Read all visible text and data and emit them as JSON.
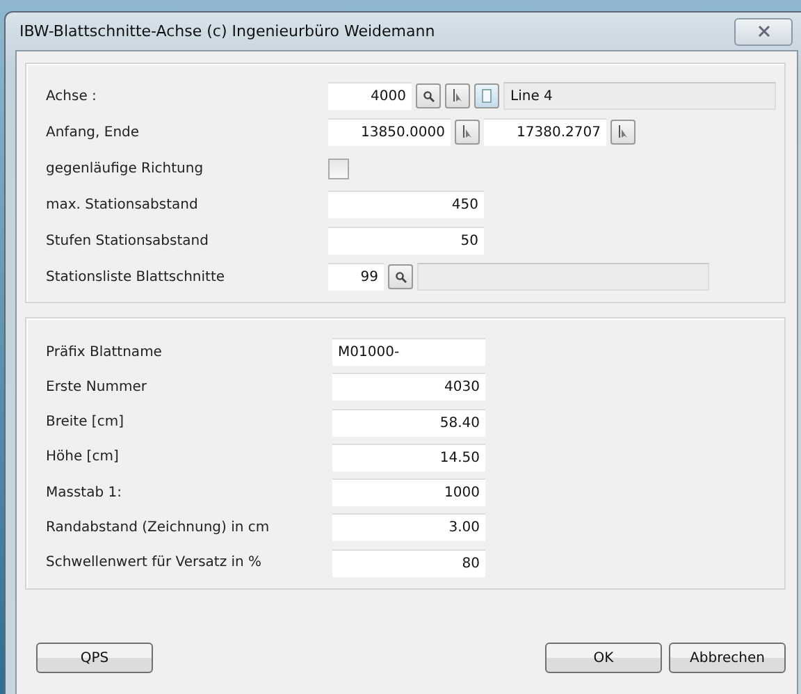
{
  "window": {
    "title": "IBW-Blattschnitte-Achse   (c) Ingenieurbüro Weidemann"
  },
  "upper_group": [
    {
      "label": "Achse :",
      "controls": [
        {
          "kind": "field",
          "value": "4000"
        },
        {
          "kind": "search"
        },
        {
          "kind": "pick"
        },
        {
          "kind": "info"
        },
        {
          "kind": "display",
          "value": "Line 4"
        }
      ]
    },
    {
      "label": "Anfang, Ende",
      "controls": [
        {
          "kind": "field",
          "value": "13850.0000"
        },
        {
          "kind": "pick"
        },
        {
          "kind": "field",
          "value": "17380.2707"
        },
        {
          "kind": "pick"
        }
      ]
    },
    {
      "label": "gegenläufige Richtung",
      "controls": [
        {
          "kind": "checkbox",
          "checked": false
        }
      ]
    },
    {
      "label": "max. Stationsabstand",
      "controls": [
        {
          "kind": "field",
          "value": "450"
        }
      ]
    },
    {
      "label": "Stufen Stationsabstand",
      "controls": [
        {
          "kind": "field",
          "value": "50"
        }
      ]
    },
    {
      "label": "Stationsliste Blattschnitte",
      "controls": [
        {
          "kind": "field",
          "value": "99"
        },
        {
          "kind": "search"
        },
        {
          "kind": "display"
        }
      ]
    }
  ],
  "lower_group": [
    {
      "label": "Präfix Blattname",
      "value": "M01000-"
    },
    {
      "label": "Erste Nummer",
      "value": "4030"
    },
    {
      "label": "Breite [cm]",
      "value": "58.40"
    },
    {
      "label": "Höhe [cm]",
      "value": "14.50"
    },
    {
      "label": "Masstab 1:",
      "value": "1000"
    },
    {
      "label": "Randabstand (Zeichnung) in cm",
      "value": "3.00"
    },
    {
      "label": "Schwellenwert für Versatz in %",
      "value": "80"
    }
  ],
  "buttons_left": [
    "QPS"
  ],
  "buttons_right": [
    "OK",
    "Abbrechen"
  ]
}
